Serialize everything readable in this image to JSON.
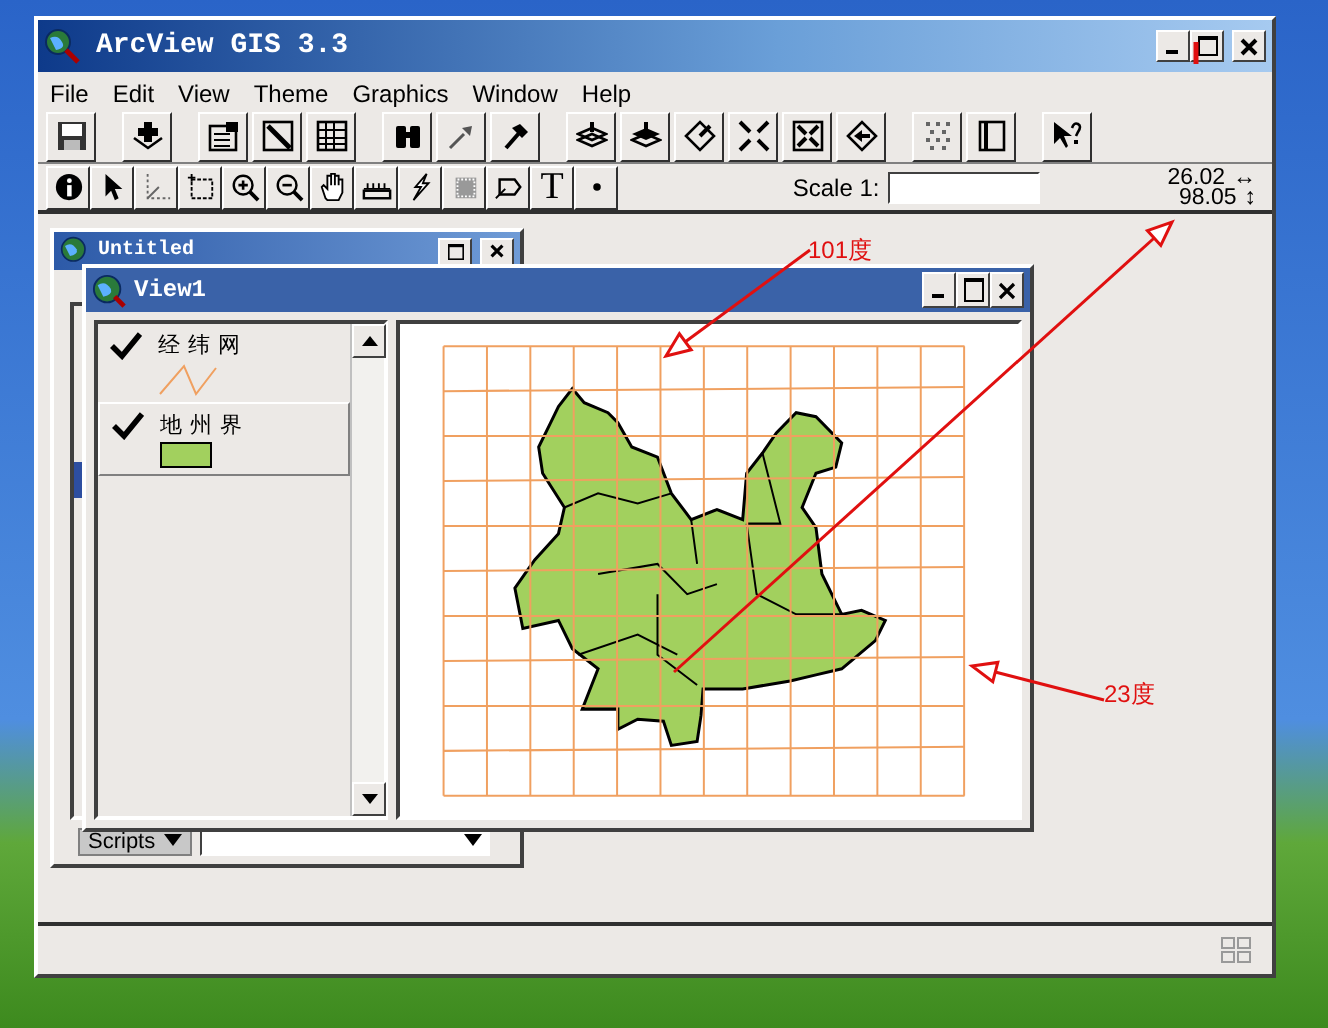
{
  "window": {
    "title": "ArcView GIS 3.3"
  },
  "menu": [
    "File",
    "Edit",
    "View",
    "Theme",
    "Graphics",
    "Window",
    "Help"
  ],
  "toolbar": [
    {
      "buttons": [
        {
          "kind": "save"
        }
      ]
    },
    {
      "buttons": [
        {
          "kind": "add-theme"
        }
      ]
    },
    {
      "buttons": [
        {
          "kind": "theme-properties"
        },
        {
          "kind": "edit-legend"
        },
        {
          "kind": "open-table"
        }
      ]
    },
    {
      "buttons": [
        {
          "kind": "find"
        },
        {
          "kind": "locate"
        },
        {
          "kind": "query"
        }
      ]
    },
    {
      "buttons": [
        {
          "kind": "zoom-full"
        },
        {
          "kind": "zoom-active"
        },
        {
          "kind": "zoom-selected"
        },
        {
          "kind": "zoom-in-fixed"
        },
        {
          "kind": "zoom-out-fixed"
        },
        {
          "kind": "zoom-previous"
        }
      ]
    },
    {
      "buttons": [
        {
          "kind": "select-none"
        },
        {
          "kind": "layout"
        }
      ]
    },
    {
      "buttons": [
        {
          "kind": "help"
        }
      ]
    }
  ],
  "tools": [
    {
      "kind": "info"
    },
    {
      "kind": "pointer"
    },
    {
      "kind": "vertex"
    },
    {
      "kind": "select-rect"
    },
    {
      "kind": "zoom-in"
    },
    {
      "kind": "zoom-out"
    },
    {
      "kind": "pan"
    },
    {
      "kind": "measure"
    },
    {
      "kind": "hotlink"
    },
    {
      "kind": "area"
    },
    {
      "kind": "label"
    },
    {
      "kind": "text",
      "label": "T"
    },
    {
      "kind": "point"
    }
  ],
  "scale": {
    "label": "Scale 1:"
  },
  "coordinates": [
    {
      "value": "26.02",
      "arrow": "↔"
    },
    {
      "value": "98.05",
      "arrow": "↕"
    }
  ],
  "project_window": {
    "title": "Untitled",
    "scripts_button": "Scripts"
  },
  "view_window": {
    "title": "View1",
    "themes": [
      {
        "name": "经纬网",
        "checked": true,
        "selected": false,
        "kind": "line",
        "color": "#f0a060"
      },
      {
        "name": "地州界",
        "checked": true,
        "selected": true,
        "kind": "fill",
        "color": "#a2d05e"
      }
    ]
  },
  "annotations": [
    {
      "text": "101度"
    },
    {
      "text": "23度"
    }
  ]
}
